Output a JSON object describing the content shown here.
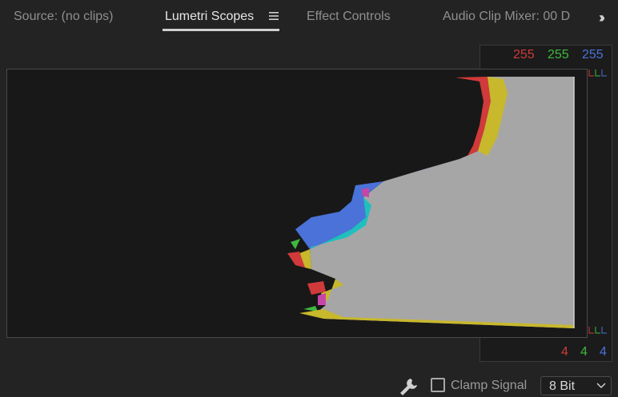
{
  "tabs": {
    "source": "Source: (no clips)",
    "lumetri": "Lumetri Scopes",
    "effect_controls": "Effect Controls",
    "audio_mixer": "Audio Clip Mixer: 00 D"
  },
  "scope": {
    "top_values": {
      "red": "255",
      "green": "255",
      "blue": "255"
    },
    "bottom_values": {
      "red": "4",
      "green": "4",
      "blue": "4"
    }
  },
  "colors": {
    "red": "#d03a3a",
    "green": "#3fb83f",
    "blue": "#4a72d8",
    "cyan": "#1fbfbf",
    "yellow": "#c8b82c",
    "magenta": "#c845a8",
    "gray": "#a6a6a6"
  },
  "footer": {
    "clamp_label": "Clamp Signal",
    "bit_depth": "8 Bit"
  },
  "icons": {
    "menu": "hamburger-menu-icon",
    "overflow": "double-chevron-right-icon",
    "settings": "wrench-icon",
    "dropdown": "chevron-down-icon"
  }
}
